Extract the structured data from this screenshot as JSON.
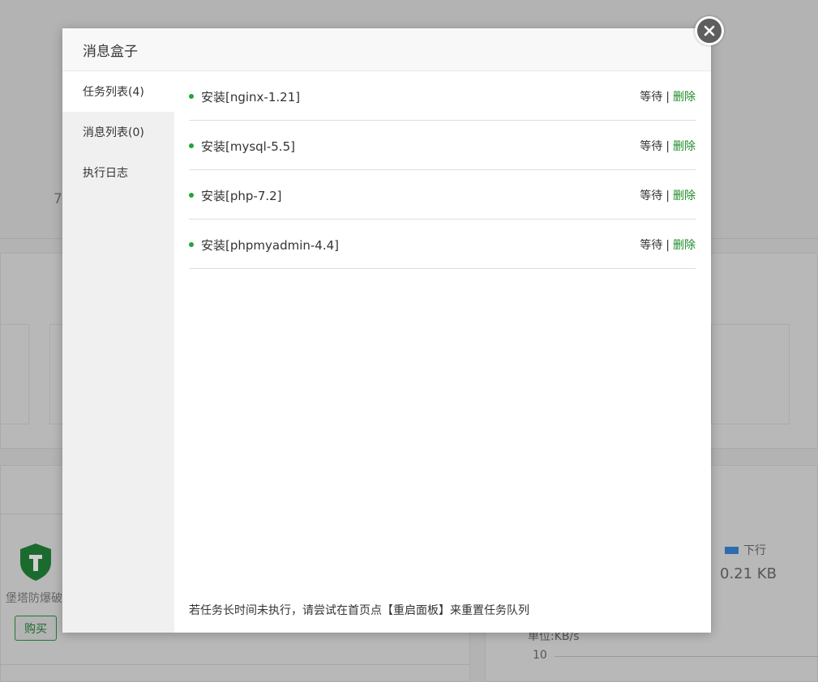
{
  "background": {
    "partial_number": "7",
    "shield_label": "堡塔防爆破",
    "buy_label": "购买",
    "legend_label": "下行",
    "download_value": "0.21 KB",
    "unit_label": "单位:KB/s",
    "axis_tick": "10"
  },
  "modal": {
    "title": "消息盒子",
    "tabs": [
      {
        "label": "任务列表(4)"
      },
      {
        "label": "消息列表(0)"
      },
      {
        "label": "执行日志"
      }
    ],
    "tasks": [
      {
        "name": "安装[nginx-1.21]",
        "status": "等待",
        "separator": "|",
        "action": "删除"
      },
      {
        "name": "安装[mysql-5.5]",
        "status": "等待",
        "separator": "|",
        "action": "删除"
      },
      {
        "name": "安装[php-7.2]",
        "status": "等待",
        "separator": "|",
        "action": "删除"
      },
      {
        "name": "安装[phpmyadmin-4.4]",
        "status": "等待",
        "separator": "|",
        "action": "删除"
      }
    ],
    "footnote": "若任务长时间未执行，请尝试在首页点【重启面板】来重置任务队列"
  },
  "colors": {
    "accent_green": "#20a53a",
    "delete_link": "#1e8c28",
    "overlay": "#b3b3b3"
  },
  "icons": {
    "close": "close-icon",
    "shield": "shield-hammer-icon",
    "status_dot": "status-dot-icon"
  }
}
